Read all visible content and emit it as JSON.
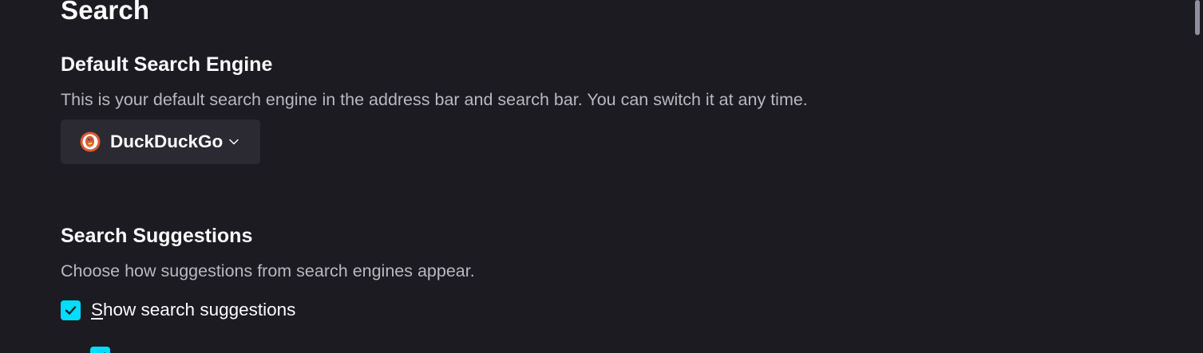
{
  "page": {
    "title": "Search"
  },
  "default_engine": {
    "heading": "Default Search Engine",
    "description": "This is your default search engine in the address bar and search bar. You can switch it at any time.",
    "selected_engine": "DuckDuckGo",
    "engine_icon": "duckduckgo-icon",
    "dropdown_icon": "chevron-down-icon"
  },
  "suggestions": {
    "heading": "Search Suggestions",
    "description": "Choose how suggestions from search engines appear.",
    "show_suggestions": {
      "label_accesskey": "S",
      "label_rest": "how search suggestions",
      "checked": true
    },
    "sub_option": {
      "checked": true
    }
  },
  "colors": {
    "background": "#1c1b22",
    "accent": "#00ddff",
    "button_bg": "#2b2a33",
    "muted_text": "#b8b8bf"
  }
}
